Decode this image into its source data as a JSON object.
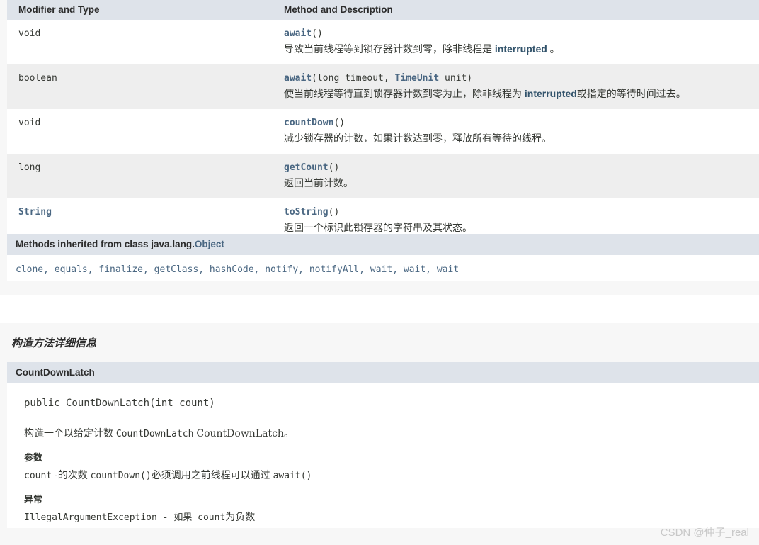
{
  "methods_table": {
    "headers": [
      "Modifier and Type",
      "Method and Description"
    ],
    "rows": [
      {
        "type": "void",
        "type_is_link": false,
        "signature_name": "await",
        "signature_args": "()",
        "desc_pre": "导致当前线程等到锁存器计数到零，除非线程是 ",
        "desc_link": "interrupted",
        "desc_post": " 。"
      },
      {
        "type": "boolean",
        "type_is_link": false,
        "signature_name": "await",
        "signature_args": "(long timeout, ",
        "signature_arg_link": "TimeUnit",
        "signature_args2": " unit)",
        "desc_pre": "使当前线程等待直到锁存器计数到零为止，除非线程为 ",
        "desc_link": "interrupted",
        "desc_post": "或指定的等待时间过去。"
      },
      {
        "type": "void",
        "type_is_link": false,
        "signature_name": "countDown",
        "signature_args": "()",
        "desc_pre": "减少锁存器的计数，如果计数达到零，释放所有等待的线程。",
        "desc_link": "",
        "desc_post": ""
      },
      {
        "type": "long",
        "type_is_link": false,
        "signature_name": "getCount",
        "signature_args": "()",
        "desc_pre": "返回当前计数。",
        "desc_link": "",
        "desc_post": ""
      },
      {
        "type": "String",
        "type_is_link": true,
        "signature_name": "toString",
        "signature_args": "()",
        "desc_pre": "返回一个标识此锁存器的字符串及其状态。",
        "desc_link": "",
        "desc_post": ""
      }
    ]
  },
  "inherited": {
    "title_prefix": "Methods inherited from class java.lang.",
    "title_link": "Object",
    "methods": "clone, equals, finalize, getClass, hashCode, notify, notifyAll, wait, wait, wait"
  },
  "constructor_detail": {
    "section_title": "构造方法详细信息",
    "name": "CountDownLatch",
    "signature": "public CountDownLatch(int count)",
    "description_pre": "构造一个以给定计数 ",
    "description_mono": "CountDownLatch",
    "description_serif": "CountDownLatch",
    "description_post": "。",
    "params_label": "参数",
    "param_name": "count",
    "param_text_1": " -的次数 ",
    "param_link_1": "countDown()",
    "param_text_2": "必须调用之前线程可以通过 ",
    "param_link_2": "await()",
    "throws_label": "异常",
    "throws_link": "IllegalArgumentException",
    "throws_text": " - 如果 ",
    "throws_param": "count",
    "throws_text_2": "为负数"
  },
  "watermark": "CSDN @仲子_real",
  "colors": {
    "header_bg": "#dee3ea",
    "alt_row_bg": "#eeeeee",
    "link": "#4a6782",
    "page_bg": "#f7f7f7",
    "text": "#353833"
  }
}
